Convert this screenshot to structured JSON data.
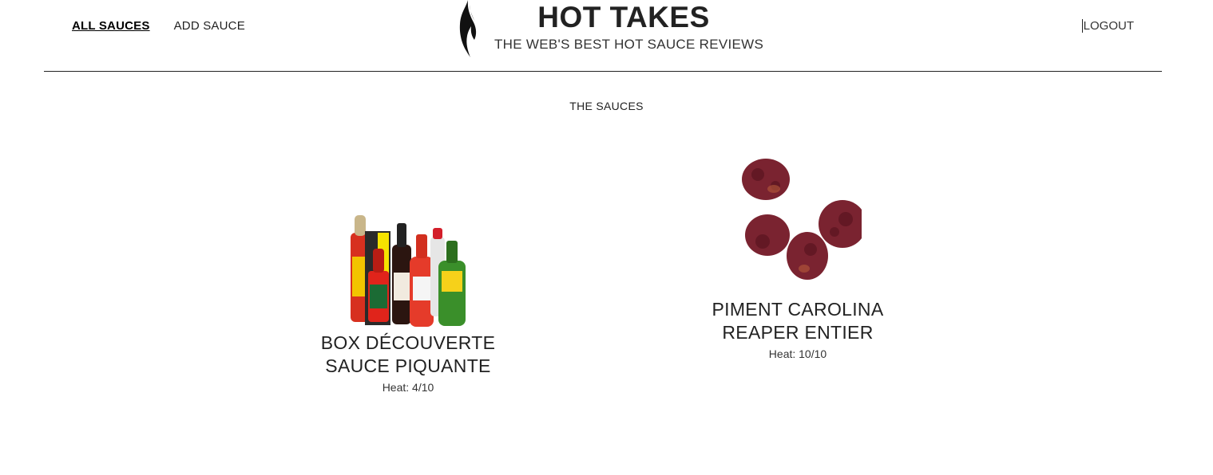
{
  "nav": {
    "all_sauces": "ALL SAUCES",
    "add_sauce": "ADD SAUCE",
    "logout": "LOGOUT"
  },
  "brand": {
    "title": "HOT TAKES",
    "subtitle": "THE WEB'S BEST HOT SAUCE REVIEWS",
    "icon": "flame-icon"
  },
  "main": {
    "section_title": "THE SAUCES",
    "sauces": [
      {
        "name": "BOX DÉCOUVERTE SAUCE PIQUANTE",
        "heat": "Heat: 4/10",
        "image": "hot-sauce-bottles-image"
      },
      {
        "name": "PIMENT CAROLINA REAPER ENTIER",
        "heat": "Heat: 10/10",
        "image": "dried-peppers-image"
      }
    ]
  }
}
